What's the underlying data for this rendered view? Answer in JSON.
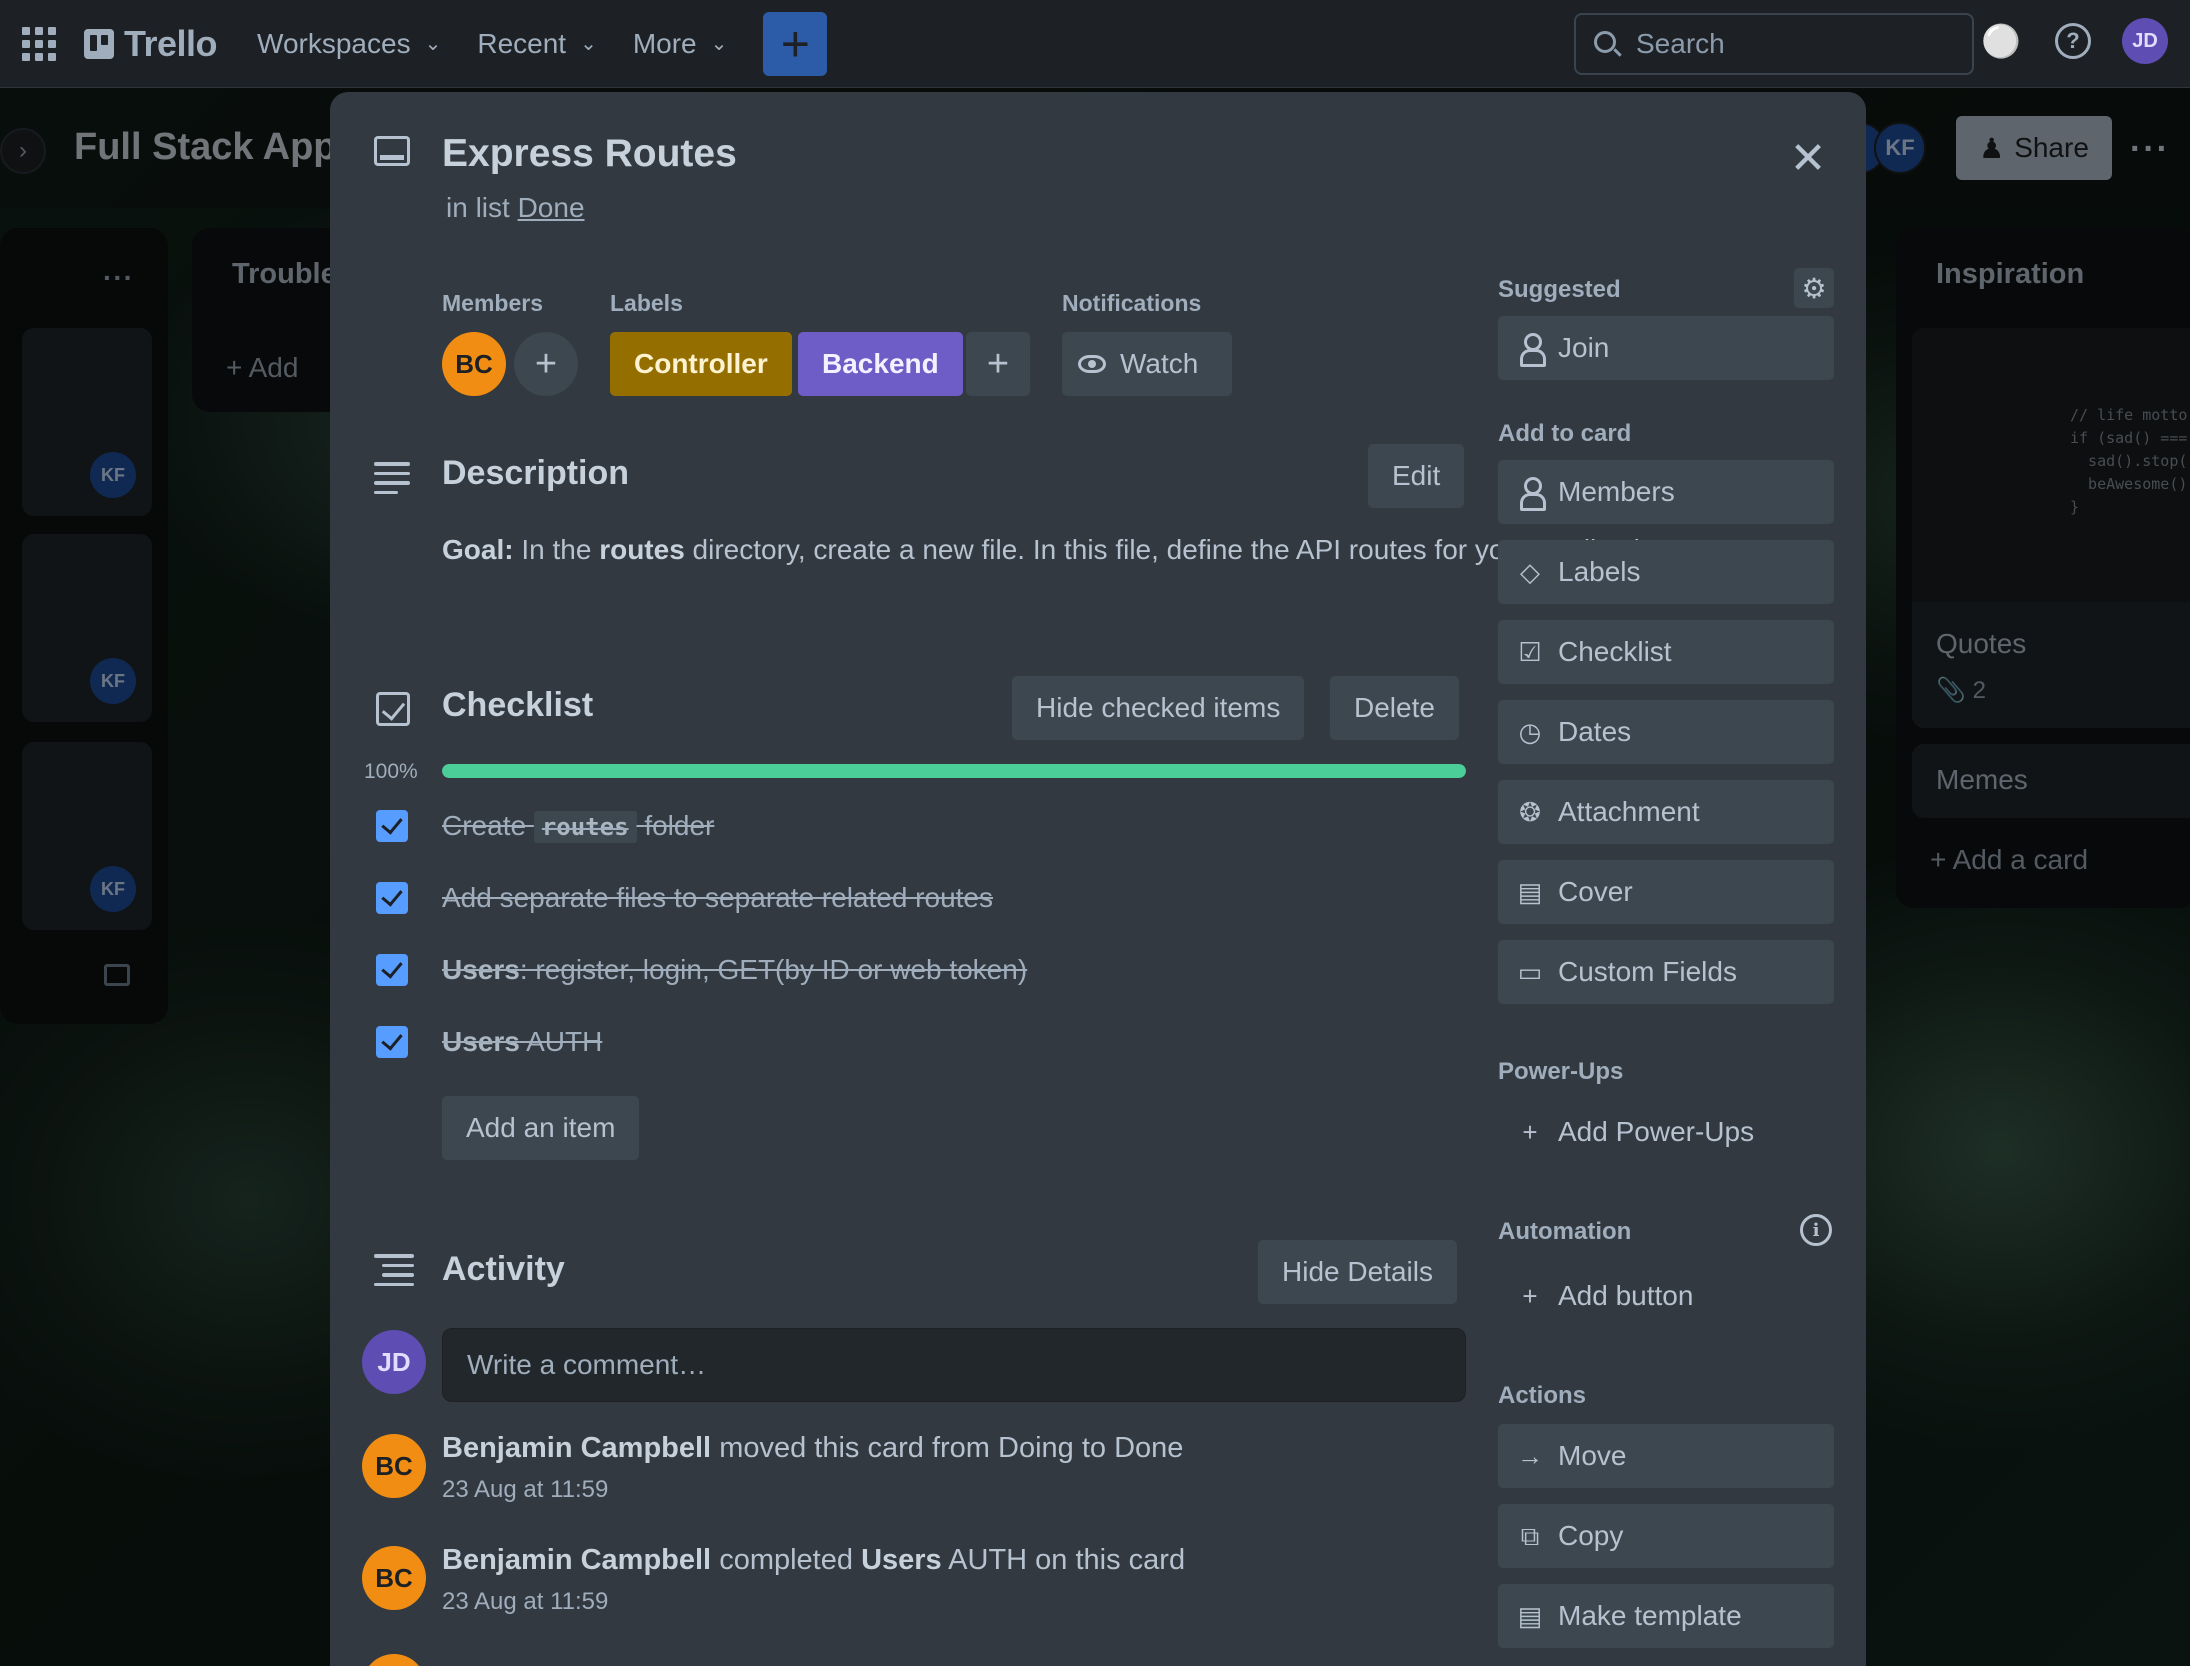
{
  "topnav": {
    "logo_text": "Trello",
    "menu": [
      {
        "label": "Workspaces"
      },
      {
        "label": "Recent"
      },
      {
        "label": "More"
      }
    ],
    "create_label": "+",
    "search_placeholder": "Search",
    "user_initials": "JD"
  },
  "board": {
    "title": "Full Stack App",
    "members": [
      "F",
      "KF"
    ],
    "share_label": "Share",
    "lists": {
      "left_list": {
        "member_initials": "KF"
      },
      "trouble_list": {
        "title": "Trouble",
        "add_label": "Add"
      },
      "inspiration_list": {
        "title": "Inspiration",
        "card_code": "// life motto\nif (sad() ===\n  sad().stop(\n  beAwesome()\n}",
        "card_title": "Quotes",
        "attachment_count": "2",
        "card2_title": "Memes",
        "add_label": "Add a card"
      }
    }
  },
  "card": {
    "title": "Express Routes",
    "in_list_prefix": "in list",
    "list_name": "Done",
    "members_heading": "Members",
    "member_initials": "BC",
    "labels_heading": "Labels",
    "labels": [
      {
        "name": "Controller",
        "color": "#946f00"
      },
      {
        "name": "Backend",
        "color": "#6e5dc6"
      }
    ],
    "notifications_heading": "Notifications",
    "watch_label": "Watch",
    "description": {
      "heading": "Description",
      "edit_label": "Edit",
      "goal_prefix": "Goal:",
      "text_1": "In the",
      "bold_word": "routes",
      "text_2": "directory, create a new file. In this file, define the API routes for your application."
    },
    "checklist": {
      "heading": "Checklist",
      "hide_label": "Hide checked items",
      "delete_label": "Delete",
      "progress_percent": 100,
      "progress_text": "100%",
      "progress_color": "#4bce97",
      "items": [
        {
          "before": "Create",
          "code": "routes",
          "after": "folder",
          "checked": true
        },
        {
          "text": "Add separate files to separate related routes",
          "checked": true
        },
        {
          "bold": "Users",
          "text": ": register, login, GET(by ID or web token)",
          "checked": true
        },
        {
          "bold": "Users",
          "text": " AUTH",
          "checked": true
        }
      ],
      "add_item_label": "Add an item"
    },
    "activity": {
      "heading": "Activity",
      "hide_details_label": "Hide Details",
      "comment_placeholder": "Write a comment…",
      "commenter_initials": "JD",
      "entries": [
        {
          "initials": "BC",
          "name": "Benjamin Campbell",
          "text": "moved this card from Doing to Done",
          "time": "23 Aug at 11:59"
        },
        {
          "initials": "BC",
          "name": "Benjamin Campbell",
          "text_1": "completed",
          "bold": "Users",
          "text_2": "AUTH on this card",
          "time": "23 Aug at 11:59"
        }
      ]
    }
  },
  "sidebar": {
    "suggested_heading": "Suggested",
    "join_label": "Join",
    "add_to_card_heading": "Add to card",
    "add_to_card": [
      {
        "label": "Members",
        "icon": "person-icon"
      },
      {
        "label": "Labels",
        "icon": "tag-icon"
      },
      {
        "label": "Checklist",
        "icon": "checkbox-icon"
      },
      {
        "label": "Dates",
        "icon": "clock-icon"
      },
      {
        "label": "Attachment",
        "icon": "paperclip-icon"
      },
      {
        "label": "Cover",
        "icon": "cover-icon"
      },
      {
        "label": "Custom Fields",
        "icon": "fields-icon"
      }
    ],
    "powerups_heading": "Power-Ups",
    "add_powerups_label": "Add Power-Ups",
    "automation_heading": "Automation",
    "add_button_label": "Add button",
    "actions_heading": "Actions",
    "actions": [
      {
        "label": "Move",
        "icon": "arrow-right-icon"
      },
      {
        "label": "Copy",
        "icon": "copy-icon"
      },
      {
        "label": "Make template",
        "icon": "template-icon"
      }
    ]
  }
}
